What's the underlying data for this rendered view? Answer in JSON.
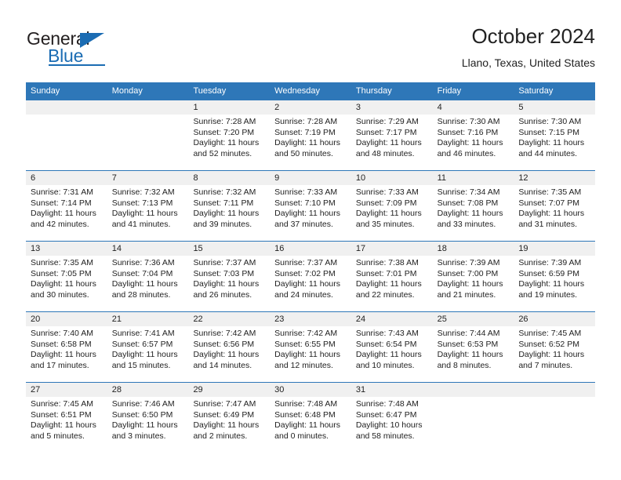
{
  "brand": {
    "name_top": "General",
    "name_bottom": "Blue",
    "accent_color": "#1b6cb3"
  },
  "header": {
    "title": "October 2024",
    "location": "Llano, Texas, United States"
  },
  "theme": {
    "header_band": "#2e77b8",
    "daynum_band": "#f0f0f0",
    "text": "#222222"
  },
  "calendar": {
    "weekdays": [
      "Sunday",
      "Monday",
      "Tuesday",
      "Wednesday",
      "Thursday",
      "Friday",
      "Saturday"
    ],
    "weeks": [
      [
        {
          "day": "",
          "sunrise": "",
          "sunset": "",
          "daylight": ""
        },
        {
          "day": "",
          "sunrise": "",
          "sunset": "",
          "daylight": ""
        },
        {
          "day": "1",
          "sunrise": "Sunrise: 7:28 AM",
          "sunset": "Sunset: 7:20 PM",
          "daylight": "Daylight: 11 hours and 52 minutes."
        },
        {
          "day": "2",
          "sunrise": "Sunrise: 7:28 AM",
          "sunset": "Sunset: 7:19 PM",
          "daylight": "Daylight: 11 hours and 50 minutes."
        },
        {
          "day": "3",
          "sunrise": "Sunrise: 7:29 AM",
          "sunset": "Sunset: 7:17 PM",
          "daylight": "Daylight: 11 hours and 48 minutes."
        },
        {
          "day": "4",
          "sunrise": "Sunrise: 7:30 AM",
          "sunset": "Sunset: 7:16 PM",
          "daylight": "Daylight: 11 hours and 46 minutes."
        },
        {
          "day": "5",
          "sunrise": "Sunrise: 7:30 AM",
          "sunset": "Sunset: 7:15 PM",
          "daylight": "Daylight: 11 hours and 44 minutes."
        }
      ],
      [
        {
          "day": "6",
          "sunrise": "Sunrise: 7:31 AM",
          "sunset": "Sunset: 7:14 PM",
          "daylight": "Daylight: 11 hours and 42 minutes."
        },
        {
          "day": "7",
          "sunrise": "Sunrise: 7:32 AM",
          "sunset": "Sunset: 7:13 PM",
          "daylight": "Daylight: 11 hours and 41 minutes."
        },
        {
          "day": "8",
          "sunrise": "Sunrise: 7:32 AM",
          "sunset": "Sunset: 7:11 PM",
          "daylight": "Daylight: 11 hours and 39 minutes."
        },
        {
          "day": "9",
          "sunrise": "Sunrise: 7:33 AM",
          "sunset": "Sunset: 7:10 PM",
          "daylight": "Daylight: 11 hours and 37 minutes."
        },
        {
          "day": "10",
          "sunrise": "Sunrise: 7:33 AM",
          "sunset": "Sunset: 7:09 PM",
          "daylight": "Daylight: 11 hours and 35 minutes."
        },
        {
          "day": "11",
          "sunrise": "Sunrise: 7:34 AM",
          "sunset": "Sunset: 7:08 PM",
          "daylight": "Daylight: 11 hours and 33 minutes."
        },
        {
          "day": "12",
          "sunrise": "Sunrise: 7:35 AM",
          "sunset": "Sunset: 7:07 PM",
          "daylight": "Daylight: 11 hours and 31 minutes."
        }
      ],
      [
        {
          "day": "13",
          "sunrise": "Sunrise: 7:35 AM",
          "sunset": "Sunset: 7:05 PM",
          "daylight": "Daylight: 11 hours and 30 minutes."
        },
        {
          "day": "14",
          "sunrise": "Sunrise: 7:36 AM",
          "sunset": "Sunset: 7:04 PM",
          "daylight": "Daylight: 11 hours and 28 minutes."
        },
        {
          "day": "15",
          "sunrise": "Sunrise: 7:37 AM",
          "sunset": "Sunset: 7:03 PM",
          "daylight": "Daylight: 11 hours and 26 minutes."
        },
        {
          "day": "16",
          "sunrise": "Sunrise: 7:37 AM",
          "sunset": "Sunset: 7:02 PM",
          "daylight": "Daylight: 11 hours and 24 minutes."
        },
        {
          "day": "17",
          "sunrise": "Sunrise: 7:38 AM",
          "sunset": "Sunset: 7:01 PM",
          "daylight": "Daylight: 11 hours and 22 minutes."
        },
        {
          "day": "18",
          "sunrise": "Sunrise: 7:39 AM",
          "sunset": "Sunset: 7:00 PM",
          "daylight": "Daylight: 11 hours and 21 minutes."
        },
        {
          "day": "19",
          "sunrise": "Sunrise: 7:39 AM",
          "sunset": "Sunset: 6:59 PM",
          "daylight": "Daylight: 11 hours and 19 minutes."
        }
      ],
      [
        {
          "day": "20",
          "sunrise": "Sunrise: 7:40 AM",
          "sunset": "Sunset: 6:58 PM",
          "daylight": "Daylight: 11 hours and 17 minutes."
        },
        {
          "day": "21",
          "sunrise": "Sunrise: 7:41 AM",
          "sunset": "Sunset: 6:57 PM",
          "daylight": "Daylight: 11 hours and 15 minutes."
        },
        {
          "day": "22",
          "sunrise": "Sunrise: 7:42 AM",
          "sunset": "Sunset: 6:56 PM",
          "daylight": "Daylight: 11 hours and 14 minutes."
        },
        {
          "day": "23",
          "sunrise": "Sunrise: 7:42 AM",
          "sunset": "Sunset: 6:55 PM",
          "daylight": "Daylight: 11 hours and 12 minutes."
        },
        {
          "day": "24",
          "sunrise": "Sunrise: 7:43 AM",
          "sunset": "Sunset: 6:54 PM",
          "daylight": "Daylight: 11 hours and 10 minutes."
        },
        {
          "day": "25",
          "sunrise": "Sunrise: 7:44 AM",
          "sunset": "Sunset: 6:53 PM",
          "daylight": "Daylight: 11 hours and 8 minutes."
        },
        {
          "day": "26",
          "sunrise": "Sunrise: 7:45 AM",
          "sunset": "Sunset: 6:52 PM",
          "daylight": "Daylight: 11 hours and 7 minutes."
        }
      ],
      [
        {
          "day": "27",
          "sunrise": "Sunrise: 7:45 AM",
          "sunset": "Sunset: 6:51 PM",
          "daylight": "Daylight: 11 hours and 5 minutes."
        },
        {
          "day": "28",
          "sunrise": "Sunrise: 7:46 AM",
          "sunset": "Sunset: 6:50 PM",
          "daylight": "Daylight: 11 hours and 3 minutes."
        },
        {
          "day": "29",
          "sunrise": "Sunrise: 7:47 AM",
          "sunset": "Sunset: 6:49 PM",
          "daylight": "Daylight: 11 hours and 2 minutes."
        },
        {
          "day": "30",
          "sunrise": "Sunrise: 7:48 AM",
          "sunset": "Sunset: 6:48 PM",
          "daylight": "Daylight: 11 hours and 0 minutes."
        },
        {
          "day": "31",
          "sunrise": "Sunrise: 7:48 AM",
          "sunset": "Sunset: 6:47 PM",
          "daylight": "Daylight: 10 hours and 58 minutes."
        },
        {
          "day": "",
          "sunrise": "",
          "sunset": "",
          "daylight": ""
        },
        {
          "day": "",
          "sunrise": "",
          "sunset": "",
          "daylight": ""
        }
      ]
    ]
  }
}
